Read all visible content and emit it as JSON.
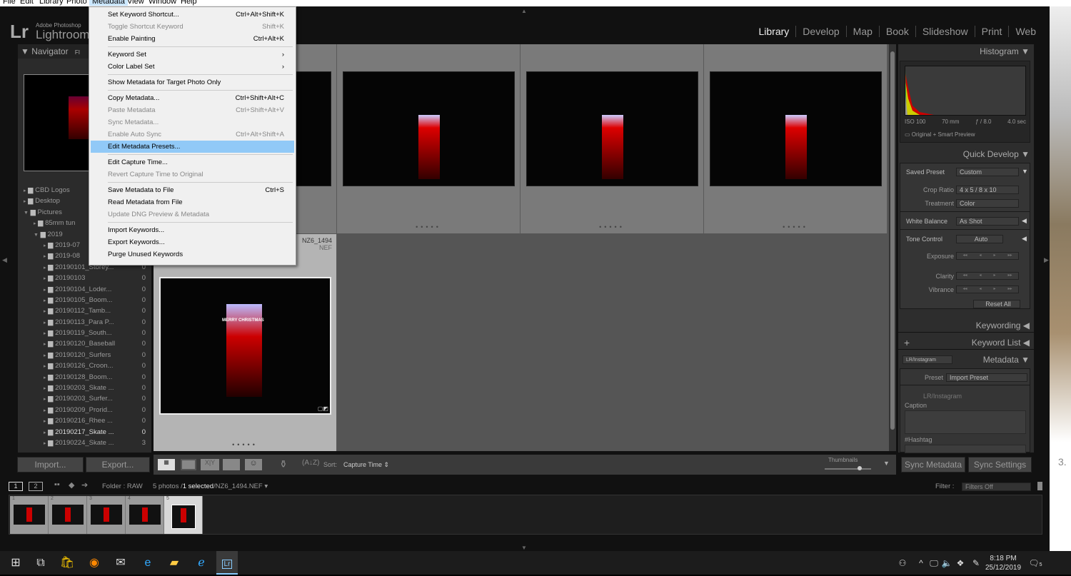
{
  "menubar": [
    "File",
    "Edit",
    "Library",
    "Photo",
    "Metadata",
    "View",
    "Window",
    "Help"
  ],
  "app": {
    "logo": "Lr",
    "brand_small": "Adobe Photoshop",
    "brand": "Lightroom C"
  },
  "modules": [
    "Library",
    "Develop",
    "Map",
    "Book",
    "Slideshow",
    "Print",
    "Web"
  ],
  "left": {
    "navigator": "Navigator",
    "nav_fit": "FI",
    "folders": [
      {
        "name": "CBD Logos",
        "count": ""
      },
      {
        "name": "Desktop",
        "count": ""
      },
      {
        "name": "Pictures",
        "count": ""
      },
      {
        "name": "85mm tun",
        "count": ""
      },
      {
        "name": "2019",
        "count": ""
      },
      {
        "name": "2019-07",
        "count": ""
      },
      {
        "name": "2019-08",
        "count": ""
      },
      {
        "name": "20190101_Storey...",
        "count": "0"
      },
      {
        "name": "20190103",
        "count": "0"
      },
      {
        "name": "20190104_Loder...",
        "count": "0"
      },
      {
        "name": "20190105_Boom...",
        "count": "0"
      },
      {
        "name": "20190112_Tamb...",
        "count": "0"
      },
      {
        "name": "20190113_Para P...",
        "count": "0"
      },
      {
        "name": "20190119_South...",
        "count": "0"
      },
      {
        "name": "20190120_Baseball",
        "count": "0"
      },
      {
        "name": "20190120_Surfers",
        "count": "0"
      },
      {
        "name": "20190126_Croon...",
        "count": "0"
      },
      {
        "name": "20190128_Boom...",
        "count": "0"
      },
      {
        "name": "20190203_Skate ...",
        "count": "0"
      },
      {
        "name": "20190203_Surfer...",
        "count": "0"
      },
      {
        "name": "20190209_Prorid...",
        "count": "0"
      },
      {
        "name": "20190216_Rhee ...",
        "count": "0"
      },
      {
        "name": "20190217_Skate ...",
        "count": "0"
      },
      {
        "name": "20190224_Skate ...",
        "count": "3"
      }
    ],
    "import": "Import...",
    "export": "Export..."
  },
  "metadata_menu": [
    {
      "label": "Set Keyword Shortcut...",
      "shortcut": "Ctrl+Alt+Shift+K"
    },
    {
      "label": "Toggle Shortcut Keyword",
      "shortcut": "Shift+K",
      "disabled": true
    },
    {
      "label": "Enable Painting",
      "shortcut": "Ctrl+Alt+K"
    },
    {
      "sep": true
    },
    {
      "label": "Keyword Set",
      "shortcut": "›"
    },
    {
      "label": "Color Label Set",
      "shortcut": "›"
    },
    {
      "sep": true
    },
    {
      "label": "Show Metadata for Target Photo Only",
      "shortcut": ""
    },
    {
      "sep": true
    },
    {
      "label": "Copy Metadata...",
      "shortcut": "Ctrl+Shift+Alt+C"
    },
    {
      "label": "Paste Metadata",
      "shortcut": "Ctrl+Shift+Alt+V",
      "disabled": true
    },
    {
      "label": "Sync Metadata...",
      "shortcut": "",
      "disabled": true
    },
    {
      "label": "Enable Auto Sync",
      "shortcut": "Ctrl+Alt+Shift+A",
      "disabled": true
    },
    {
      "label": "Edit Metadata Presets...",
      "shortcut": "",
      "highlighted": true
    },
    {
      "sep": true
    },
    {
      "label": "Edit Capture Time...",
      "shortcut": ""
    },
    {
      "label": "Revert Capture Time to Original",
      "shortcut": "",
      "disabled": true
    },
    {
      "sep": true
    },
    {
      "label": "Save Metadata to File",
      "shortcut": "Ctrl+S"
    },
    {
      "label": "Read Metadata from File",
      "shortcut": ""
    },
    {
      "label": "Update DNG Preview & Metadata",
      "shortcut": "",
      "disabled": true
    },
    {
      "sep": true
    },
    {
      "label": "Import Keywords...",
      "shortcut": ""
    },
    {
      "label": "Export Keywords...",
      "shortcut": ""
    },
    {
      "label": "Purge Unused Keywords",
      "shortcut": ""
    }
  ],
  "grid": {
    "selected_name": "NZ6_1494",
    "selected_ext": "NEF",
    "photo_caption": "MERRY CHRISTMAS"
  },
  "toolbar": {
    "sort_label": "Sort:",
    "sort_value": "Capture Time",
    "thumbnails": "Thumbnails",
    "thumb_size_pct": 70
  },
  "right": {
    "histogram": "Histogram",
    "iso": "ISO 100",
    "focal": "70 mm",
    "aperture": "ƒ / 8.0",
    "shutter": "4.0 sec",
    "preview": "Original + Smart Preview",
    "quick_develop": "Quick Develop",
    "saved_preset": "Saved Preset",
    "saved_preset_val": "Custom",
    "crop_ratio": "Crop Ratio",
    "crop_ratio_val": "4 x 5  /  8 x 10",
    "treatment": "Treatment",
    "treatment_val": "Color",
    "white_balance": "White Balance",
    "white_balance_val": "As Shot",
    "tone_control": "Tone Control",
    "auto": "Auto",
    "exposure": "Exposure",
    "clarity": "Clarity",
    "vibrance": "Vibrance",
    "reset_all": "Reset All",
    "keywording": "Keywording",
    "keyword_list": "Keyword List",
    "metadata": "Metadata",
    "metadata_set": "LR/Instagram",
    "preset": "Preset",
    "preset_val": "Import Preset",
    "set_title": "LR/Instagram",
    "caption": "Caption",
    "hashtag": "#Hashtag",
    "sync_metadata": "Sync Metadata",
    "sync_settings": "Sync Settings"
  },
  "filmbar": {
    "view1": "1",
    "view2": "2",
    "folder": "Folder : RAW",
    "count": "5 photos /",
    "selected": "1 selected",
    "file": "/NZ6_1494.NEF",
    "filter_label": "Filter :",
    "filter_val": "Filters Off"
  },
  "filmstrip": [
    "1",
    "2",
    "3",
    "4",
    "5"
  ],
  "taskbar": {
    "time": "8:18 PM",
    "date": "25/12/2019",
    "notifications": "5"
  },
  "desktop_text": "3."
}
